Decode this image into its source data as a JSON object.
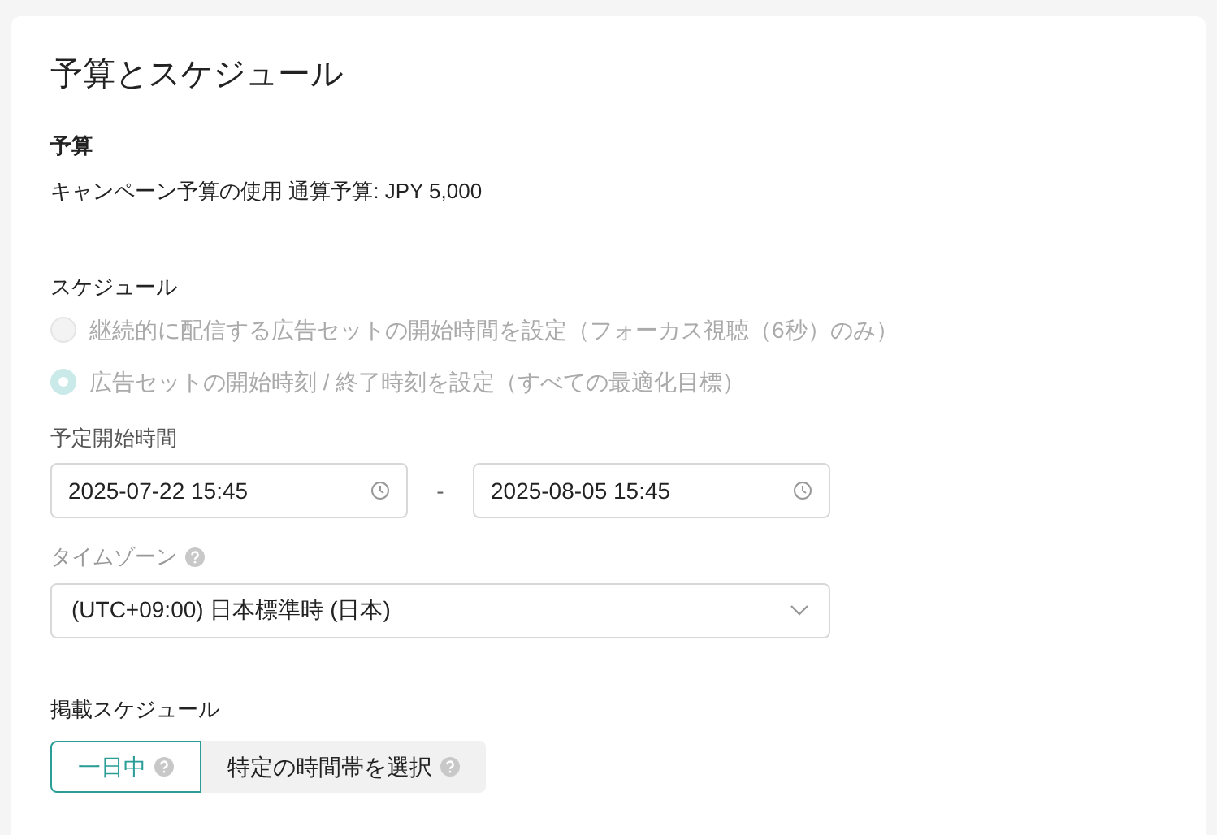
{
  "title": "予算とスケジュール",
  "budget": {
    "label": "予算",
    "text": "キャンペーン予算の使用 通算予算: JPY 5,000"
  },
  "schedule": {
    "label": "スケジュール",
    "options": [
      {
        "label": "継続的に配信する広告セットの開始時間を設定（フォーカス視聴（6秒）のみ）",
        "selected": false,
        "disabled": true
      },
      {
        "label": "広告セットの開始時刻 / 終了時刻を設定（すべての最適化目標）",
        "selected": true,
        "disabled": true
      }
    ]
  },
  "start_time": {
    "label": "予定開始時間",
    "start": "2025-07-22 15:45",
    "separator": "-",
    "end": "2025-08-05 15:45"
  },
  "timezone": {
    "label": "タイムゾーン",
    "value": "(UTC+09:00) 日本標準時 (日本)"
  },
  "delivery_schedule": {
    "label": "掲載スケジュール",
    "segments": [
      {
        "label": "一日中",
        "selected": true
      },
      {
        "label": "特定の時間帯を選択",
        "selected": false
      }
    ]
  }
}
